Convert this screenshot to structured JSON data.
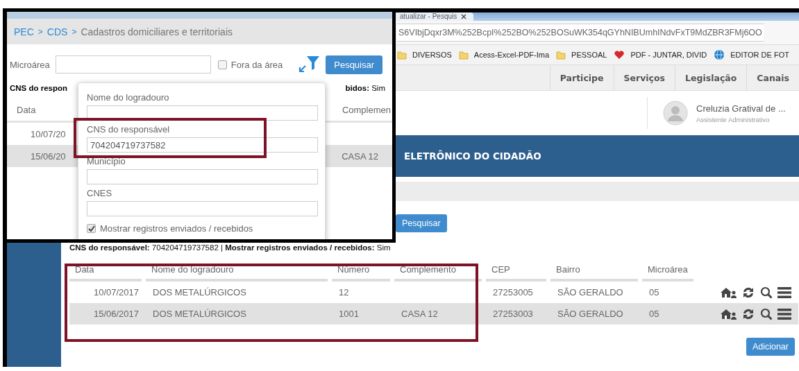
{
  "browser": {
    "tabs": [
      {
        "label": "atualizar - Pesquis",
        "selected": true
      }
    ],
    "url": "S6VIbjDqxr3M%252BcpI%252BO%252BOSuWK354qGYhNIBUmhINdvFxT9MdZBR3FMj6OO",
    "bookmarks": [
      {
        "label": "DIVERSOS",
        "kind": "folder"
      },
      {
        "label": "Acess-Excel-PDF-Ima",
        "kind": "folder"
      },
      {
        "label": "PESSOAL",
        "kind": "folder"
      },
      {
        "label": "PDF - JUNTAR, DIVID",
        "kind": "heart"
      },
      {
        "label": "EDITOR DE FOT",
        "kind": "globe"
      }
    ]
  },
  "site_nav": [
    "Participe",
    "Serviços",
    "Legislação",
    "Canais"
  ],
  "user": {
    "name": "Creluzia Gratival de ...",
    "role": "Assistente Administrativo"
  },
  "banner": "ELETRÔNICO DO CIDADÃO",
  "search_button": "Pesquisar",
  "filter_summary": "**CNS do responsável:** 704204719737582 | **Mostrar registros enviados / recebidos:** Sim",
  "table": {
    "columns": [
      "Data",
      "Nome do logradouro",
      "Número",
      "Complemento",
      "CEP",
      "Bairro",
      "Microárea"
    ],
    "rows": [
      {
        "cells": [
          "10/07/2017",
          "DOS METALÚRGICOS",
          "12",
          "",
          "27253005",
          "SÃO GERALDO",
          "05"
        ]
      },
      {
        "cells": [
          "15/06/2017",
          "DOS METALÚRGICOS",
          "1001",
          "CASA 12",
          "27253003",
          "SÃO GERALDO",
          "05"
        ]
      }
    ]
  },
  "add_button": "Adicionar",
  "zoom_inset": {
    "breadcrumb": [
      {
        "label": "PEC",
        "kind": "link"
      },
      {
        "label": "CDS",
        "kind": "link"
      },
      {
        "label": "Cadastros domiciliares e territoriais",
        "kind": "current"
      }
    ],
    "separator": ">",
    "microarea_label": "Microárea",
    "outside_area": {
      "label": "Fora da área",
      "checked": false
    },
    "search_button": "Pesquisar",
    "summary_left": "CNS do respon",
    "summary_right": "**bidos:** Sim",
    "columns": [
      "Data",
      "Complemen"
    ],
    "rows": [
      {
        "date": "10/07/20"
      },
      {
        "date": "15/06/20",
        "complement": "CASA 12"
      }
    ],
    "popup": {
      "fields": [
        {
          "label": "Nome do logradouro"
        },
        {
          "label": "CNS do responsável",
          "value": "704204719737582"
        },
        {
          "label": "Município"
        },
        {
          "label": "CNES"
        }
      ],
      "show_sent": {
        "label": "Mostrar registros enviados / recebidos",
        "checked": true
      }
    }
  }
}
